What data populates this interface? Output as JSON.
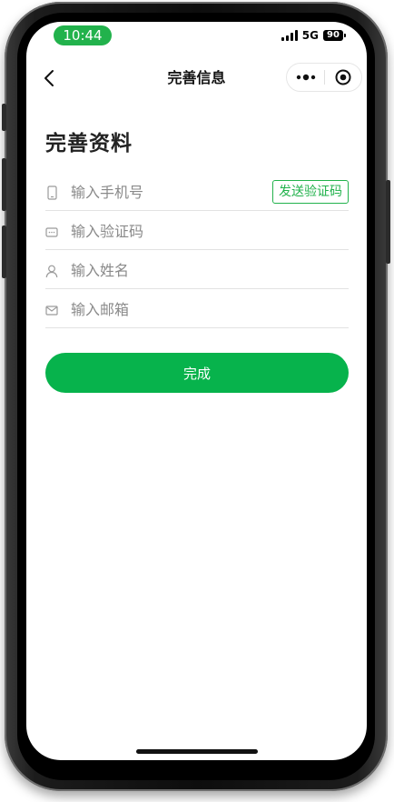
{
  "status_bar": {
    "time": "10:44",
    "network": "5G",
    "battery": "90"
  },
  "nav": {
    "title": "完善信息"
  },
  "page": {
    "title": "完善资料"
  },
  "form": {
    "phone_placeholder": "输入手机号",
    "send_code_label": "发送验证码",
    "code_placeholder": "输入验证码",
    "name_placeholder": "输入姓名",
    "email_placeholder": "输入邮箱",
    "submit_label": "完成"
  },
  "colors": {
    "accent": "#07b34c",
    "time_pill": "#22b24c"
  },
  "icons": [
    "back-arrow-icon",
    "more-dots-icon",
    "target-close-icon",
    "phone-icon",
    "sms-code-icon",
    "person-icon",
    "mail-icon"
  ]
}
